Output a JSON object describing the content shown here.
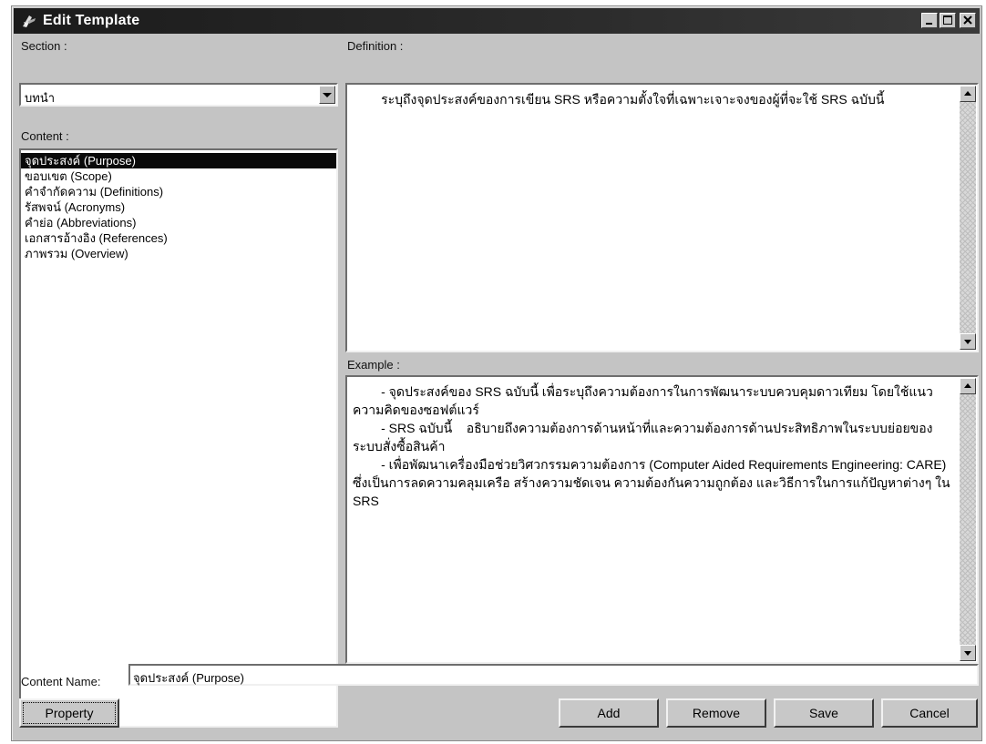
{
  "window": {
    "title": "Edit Template"
  },
  "section": {
    "label": "Section :",
    "value": "บทนำ"
  },
  "content": {
    "label": "Content :",
    "items": [
      "จุดประสงค์ (Purpose)",
      "ขอบเขต (Scope)",
      "คำจำกัดความ (Definitions)",
      "รัสพจน์ (Acronyms)",
      "คำย่อ (Abbreviations)",
      "เอกสารอ้างอิง (References)",
      "ภาพรวม (Overview)"
    ],
    "selected_index": 0
  },
  "definition": {
    "label": "Definition :",
    "text": "        ระบุถึงจุดประสงค์ของการเขียน SRS หรือความตั้งใจที่เฉพาะเจาะจงของผู้ที่จะใช้ SRS ฉบับนี้"
  },
  "example": {
    "label": "Example :",
    "text": "        - จุดประสงค์ของ SRS ฉบับนี้ เพื่อระบุถึงความต้องการในการพัฒนาระบบควบคุมดาวเทียม โดยใช้แนวความคิดของซอฟต์แวร์\n        - SRS ฉบับนี้    อธิบายถึงความต้องการด้านหน้าที่และความต้องการด้านประสิทธิภาพในระบบย่อยของระบบสั่งซื้อสินค้า\n        - เพื่อพัฒนาเครื่องมือช่วยวิศวกรรมความต้องการ (Computer Aided Requirements Engineering: CARE) ซึ่งเป็นการลดความคลุมเครือ สร้างความชัดเจน ความต้องกันความถูกต้อง และวิธีการในการแก้ปัญหาต่างๆ ใน SRS"
  },
  "content_name": {
    "label": "Content Name:",
    "value": "จุดประสงค์ (Purpose)"
  },
  "buttons": {
    "property": "Property",
    "add": "Add",
    "remove": "Remove",
    "save": "Save",
    "cancel": "Cancel"
  },
  "icons": {
    "title": "template-edit-icon",
    "minimize": "minimize-icon",
    "maximize": "maximize-icon",
    "close": "close-icon",
    "dropdown": "chevron-down-icon",
    "scroll_up": "scroll-up-icon",
    "scroll_down": "scroll-down-icon"
  }
}
